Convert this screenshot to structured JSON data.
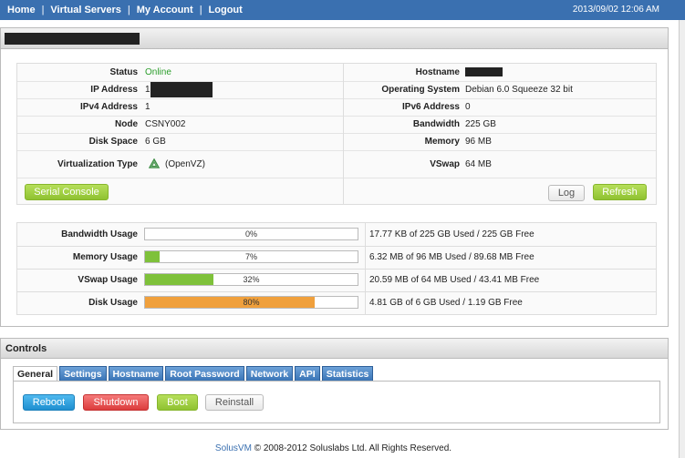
{
  "nav": {
    "items": [
      "Home",
      "Virtual Servers",
      "My Account",
      "Logout"
    ],
    "separator": "|",
    "datetime": "2013/09/02 12:06 AM"
  },
  "server": {
    "left": [
      {
        "label": "Status",
        "value": "Online"
      },
      {
        "label": "IP Address",
        "value": "1"
      },
      {
        "label": "IPv4 Address",
        "value": "1"
      },
      {
        "label": "Node",
        "value": "CSNY002"
      },
      {
        "label": "Disk Space",
        "value": "6 GB"
      },
      {
        "label": "Virtualization Type",
        "value": "(OpenVZ)"
      }
    ],
    "right": [
      {
        "label": "Hostname",
        "value": ""
      },
      {
        "label": "Operating System",
        "value": "Debian 6.0 Squeeze 32 bit"
      },
      {
        "label": "IPv6 Address",
        "value": "0"
      },
      {
        "label": "Bandwidth",
        "value": "225 GB"
      },
      {
        "label": "Memory",
        "value": "96 MB"
      },
      {
        "label": "VSwap",
        "value": "64 MB"
      }
    ],
    "status_color": "#2a9d2a"
  },
  "buttons": {
    "serial_console": "Serial Console",
    "log": "Log",
    "refresh": "Refresh"
  },
  "usage": [
    {
      "label": "Bandwidth Usage",
      "percent": 0,
      "percent_text": "0%",
      "color": "#8fc231",
      "detail": "17.77 KB of 225 GB Used / 225 GB Free"
    },
    {
      "label": "Memory Usage",
      "percent": 7,
      "percent_text": "7%",
      "color": "#7ec13a",
      "detail": "6.32 MB of 96 MB Used / 89.68 MB Free"
    },
    {
      "label": "VSwap Usage",
      "percent": 32,
      "percent_text": "32%",
      "color": "#7ec13a",
      "detail": "20.59 MB of 64 MB Used / 43.41 MB Free"
    },
    {
      "label": "Disk Usage",
      "percent": 80,
      "percent_text": "80%",
      "color": "#f0a03c",
      "detail": "4.81 GB of 6 GB Used / 1.19 GB Free"
    }
  ],
  "controls": {
    "title": "Controls",
    "tabs": [
      "General",
      "Settings",
      "Hostname",
      "Root Password",
      "Network",
      "API",
      "Statistics"
    ],
    "active_tab": "General",
    "actions": {
      "reboot": "Reboot",
      "shutdown": "Shutdown",
      "boot": "Boot",
      "reinstall": "Reinstall"
    }
  },
  "footer": {
    "brand": "SolusVM",
    "text": "© 2008-2012 Soluslabs Ltd. All Rights Reserved."
  }
}
